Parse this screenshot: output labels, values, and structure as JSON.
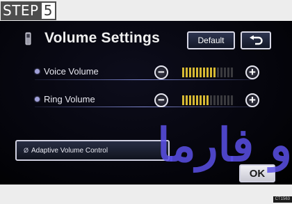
{
  "step": {
    "word": "STEP",
    "number": "5"
  },
  "screen": {
    "title": "Volume Settings",
    "default_button": "Default",
    "back_icon": "return-arrow-icon",
    "phone_icon": "mobile-phone-icon",
    "rows": [
      {
        "label": "Voice Volume",
        "level": 0.67,
        "minus": "−",
        "plus": "+"
      },
      {
        "label": "Ring Volume",
        "level": 0.5,
        "minus": "−",
        "plus": "+"
      }
    ],
    "adaptive": {
      "check_symbol": "Ø",
      "label": "Adaptive Volume Control"
    },
    "ok_button": "OK"
  },
  "watermark": {
    "text": "ﻭ ﻓﺎرﻣﺎ",
    "color": "#5a50e6"
  },
  "catalog_code": "CT1563",
  "colors": {
    "meter_on": "#d6b933",
    "meter_off": "#3a3a3e",
    "accent_bullet": "#a0a0d8"
  }
}
